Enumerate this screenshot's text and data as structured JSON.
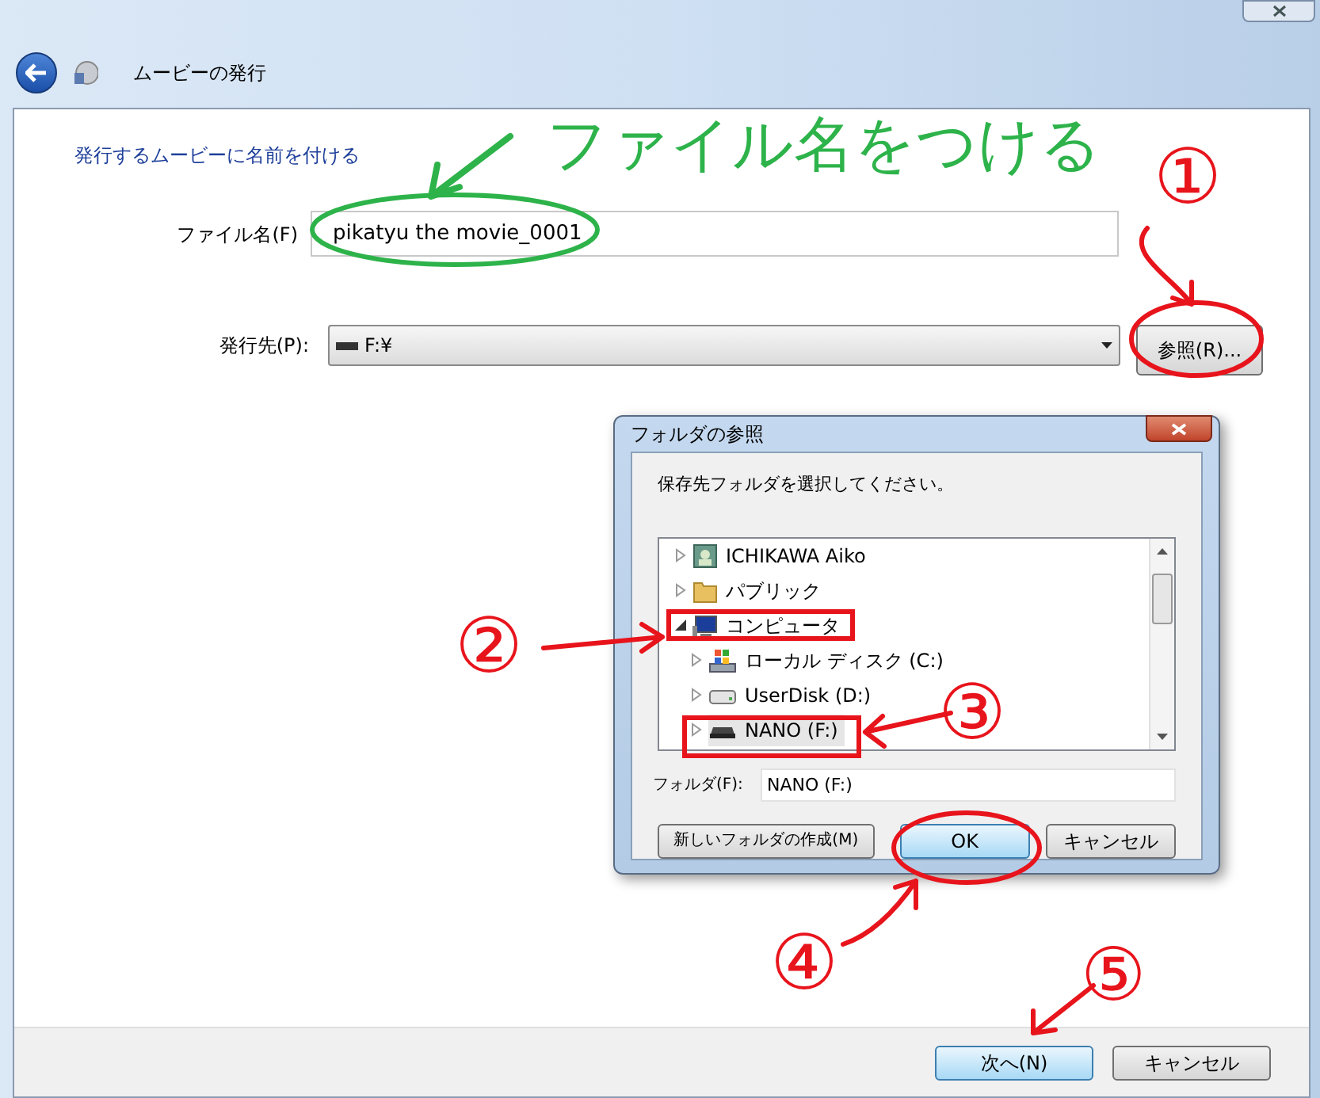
{
  "window": {
    "title": "ムービーの発行"
  },
  "heading": "発行するムービーに名前を付ける",
  "file_name": {
    "label": "ファイル名(F)",
    "value": "pikatyu the movie_0001"
  },
  "destination": {
    "label": "発行先(P):",
    "value": "F:¥",
    "browse_button": "参照(R)..."
  },
  "footer_buttons": [
    {
      "label": "次へ(N)",
      "default": true
    },
    {
      "label": "キャンセル",
      "default": false
    }
  ],
  "folder_dialog": {
    "title": "フォルダの参照",
    "prompt": "保存先フォルダを選択してください。",
    "tree": [
      {
        "label": "ICHIKAWA Aiko",
        "kind": "user",
        "expanded": false,
        "selected": false
      },
      {
        "label": "パブリック",
        "kind": "folder",
        "expanded": false,
        "selected": false
      },
      {
        "label": "コンピュータ",
        "kind": "computer",
        "expanded": true,
        "selected": false,
        "children": [
          {
            "label": "ローカル ディスク (C:)",
            "kind": "system-drive",
            "expanded": false,
            "selected": false
          },
          {
            "label": "UserDisk (D:)",
            "kind": "drive",
            "expanded": false,
            "selected": false
          },
          {
            "label": "NANO (F:)",
            "kind": "removable-drive",
            "expanded": false,
            "selected": true
          }
        ]
      }
    ],
    "folder_field": {
      "label": "フォルダ(F):",
      "value": "NANO (F:)"
    },
    "buttons": [
      {
        "label": "新しいフォルダの作成(M)",
        "default": false
      },
      {
        "label": "OK",
        "default": true
      },
      {
        "label": "キャンセル",
        "default": false
      }
    ]
  },
  "annotations": [
    {
      "text": "ファイル名をつける",
      "color": "#2db34a"
    },
    {
      "text": "①",
      "color": "#e8141c"
    },
    {
      "text": "②",
      "color": "#e8141c"
    },
    {
      "text": "③",
      "color": "#e8141c"
    },
    {
      "text": "④",
      "color": "#e8141c"
    },
    {
      "text": "⑤",
      "color": "#e8141c"
    }
  ]
}
